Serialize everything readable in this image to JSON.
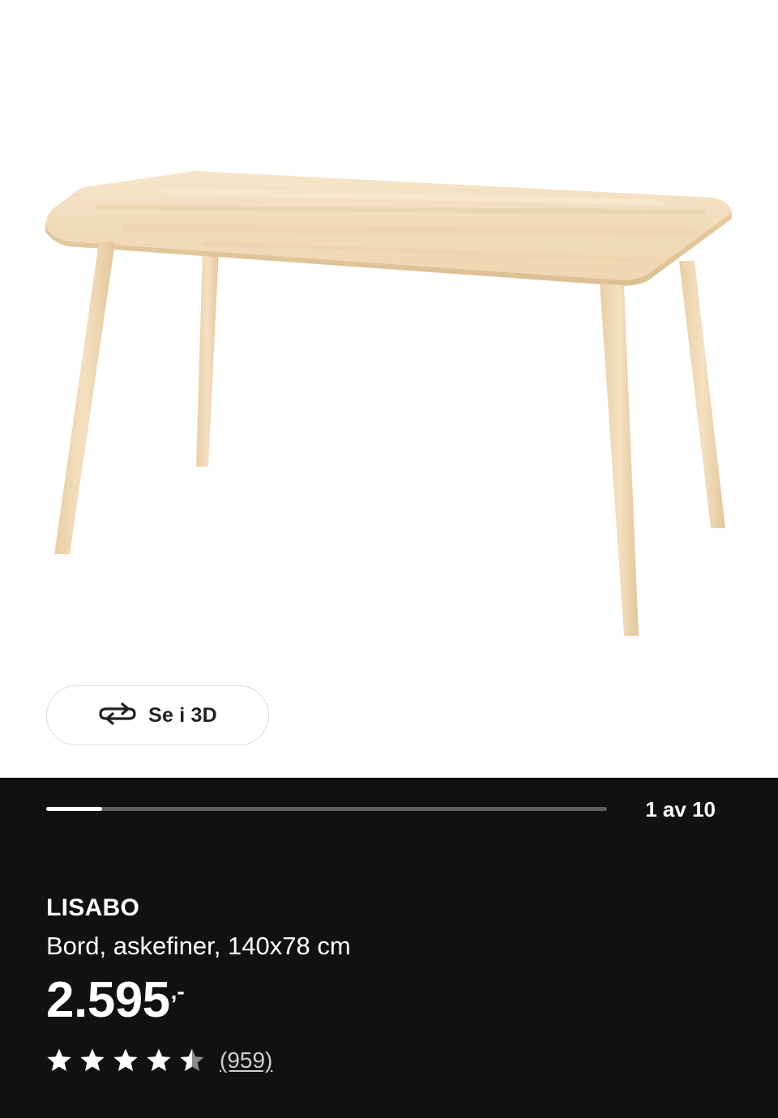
{
  "gallery": {
    "view_3d_label": "Se i 3D",
    "view_3d_icon": "rotate-3d-icon",
    "counter": "1 av 10",
    "progress": 0.1
  },
  "product": {
    "name": "LISABO",
    "description": "Bord, askefiner, 140x78 cm",
    "price": "2.595",
    "price_suffix": ",-",
    "rating": 4.5,
    "rating_max": 5,
    "review_count": "(959)"
  },
  "colors": {
    "panel_background": "#111111",
    "progress_track": "#5c5c5c",
    "progress_fill": "#ffffff",
    "table_wood": "#f2dcbc"
  }
}
